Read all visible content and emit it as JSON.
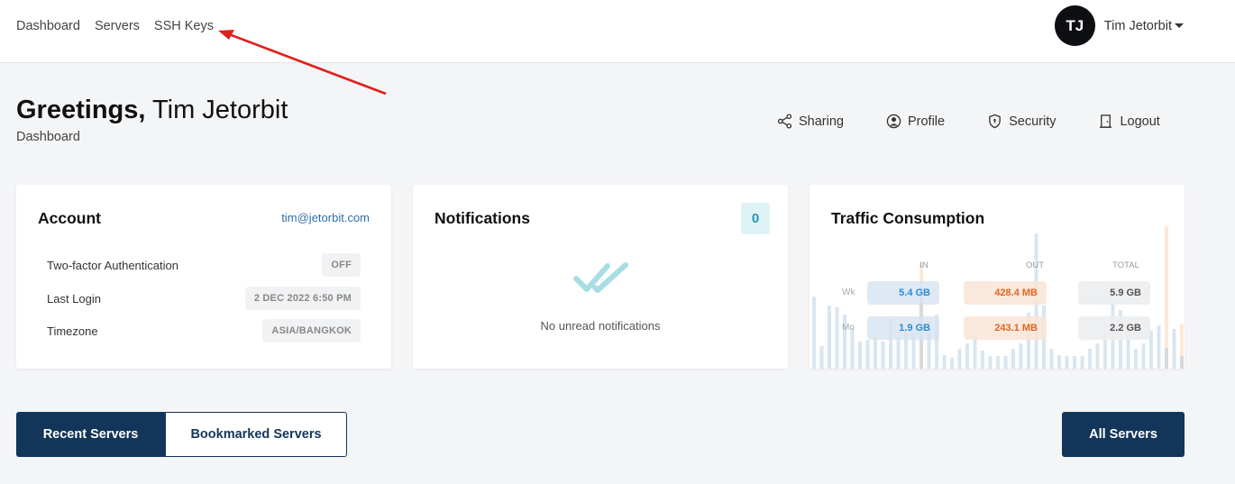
{
  "nav": {
    "items": [
      "Dashboard",
      "Servers",
      "SSH Keys"
    ]
  },
  "user": {
    "initials": "TJ",
    "name": "Tim Jetorbit"
  },
  "greeting": {
    "bold": "Greetings,",
    "name": "Tim Jetorbit",
    "subtitle": "Dashboard"
  },
  "actions": {
    "sharing": "Sharing",
    "profile": "Profile",
    "security": "Security",
    "logout": "Logout"
  },
  "account": {
    "title": "Account",
    "email": "tim@jetorbit.com",
    "rows": [
      {
        "label": "Two-factor Authentication",
        "value": "OFF"
      },
      {
        "label": "Last Login",
        "value": "2 DEC 2022 6:50 PM"
      },
      {
        "label": "Timezone",
        "value": "ASIA/BANGKOK"
      }
    ]
  },
  "notifications": {
    "title": "Notifications",
    "count": "0",
    "empty": "No unread notifications"
  },
  "traffic": {
    "title": "Traffic Consumption",
    "headers": {
      "in": "IN",
      "out": "OUT",
      "total": "TOTAL"
    },
    "rows": [
      {
        "label": "Wk",
        "in": "5.4 GB",
        "out": "428.4 MB",
        "total": "5.9 GB"
      },
      {
        "label": "Mo",
        "in": "1.9 GB",
        "out": "243.1 MB",
        "total": "2.2 GB"
      }
    ]
  },
  "tabs": {
    "recent": "Recent Servers",
    "bookmarked": "Bookmarked Servers"
  },
  "all_servers": "All Servers",
  "colors": {
    "primary": "#13355a",
    "link": "#2f6ea9",
    "teal": "#1e9bb0",
    "in": "#2f8bd6",
    "out": "#e0661e"
  }
}
